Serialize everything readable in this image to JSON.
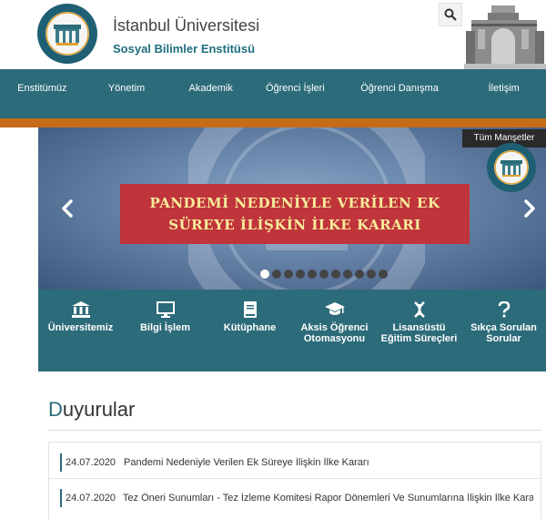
{
  "header": {
    "university": "İstanbul Üniversitesi",
    "institute": "Sosyal Bilimler Enstitüsü"
  },
  "nav": {
    "items": [
      {
        "label": "Enstitümüz"
      },
      {
        "label": "Yönetim"
      },
      {
        "label": "Akademik"
      },
      {
        "label": "Öğrenci İşleri"
      },
      {
        "label": "Öğrenci Danışma"
      },
      {
        "label": "İletişim"
      }
    ]
  },
  "slider": {
    "headline_line1": "PANDEMİ NEDENİYLE VERİLEN EK",
    "headline_line2": "SÜREYE İLİŞKİN İLKE KARARI",
    "all_headlines": "Tüm Manşetler",
    "slide_count": 11,
    "active_slide": 1
  },
  "quick_links": [
    {
      "label": "Üniversitemiz",
      "icon": "bank-icon"
    },
    {
      "label": "Bilgi İşlem",
      "icon": "monitor-icon"
    },
    {
      "label": "Kütüphane",
      "icon": "book-icon"
    },
    {
      "label": "Aksis Öğrenci Otomasyonu",
      "icon": "graduation-cap-icon"
    },
    {
      "label": "Lisansüstü Eğitim Süreçleri",
      "icon": "dna-icon"
    },
    {
      "label": "Sıkça Sorulan Sorular",
      "icon": "question-icon"
    }
  ],
  "announcements": {
    "title_first": "D",
    "title_rest": "uyurular",
    "items": [
      {
        "date": "24.07.2020",
        "text": "Pandemi Nedeniyle Verilen Ek Süreye İlişkin İlke Kararı"
      },
      {
        "date": "24.07.2020",
        "text": "Tez Öneri Sunumları - Tez İzleme Komitesi Rapor Dönemleri Ve Sunumlarına İlişkin İlke Kararı"
      }
    ]
  },
  "colors": {
    "teal": "#2c6b79",
    "orange": "#c56b1a",
    "banner_red": "#c0343b",
    "banner_text": "#f7ec9b"
  }
}
